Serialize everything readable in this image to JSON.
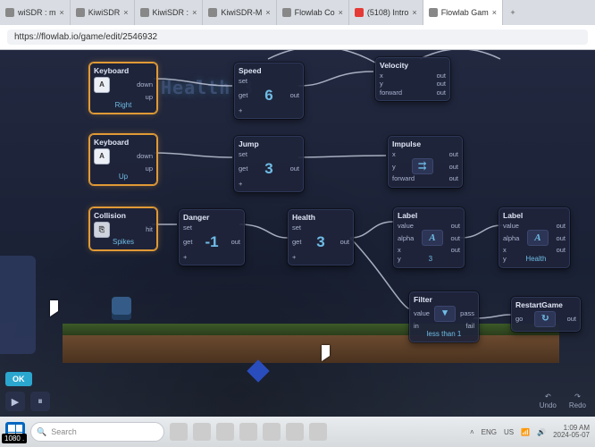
{
  "browser": {
    "tabs": [
      {
        "title": "wiSDR : m",
        "active": false
      },
      {
        "title": "KiwiSDR",
        "active": false
      },
      {
        "title": "KiwiSDR :",
        "active": false
      },
      {
        "title": "KiwiSDR-M",
        "active": false
      },
      {
        "title": "Flowlab Co",
        "active": false
      },
      {
        "title": "(5108) Intro",
        "active": false,
        "red": true
      },
      {
        "title": "Flowlab Gam",
        "active": true
      }
    ],
    "address": "https://flowlab.io/game/edit/2546932"
  },
  "hud": {
    "health_label": "Health 3"
  },
  "nodes": {
    "kb_right": {
      "title": "Keyboard",
      "key": "A",
      "p1": "down",
      "p2": "up",
      "sub": "Right"
    },
    "kb_up": {
      "title": "Keyboard",
      "key": "A",
      "p1": "down",
      "p2": "up",
      "sub": "Up"
    },
    "collision": {
      "title": "Collision",
      "p1": "hit",
      "sub": "Spikes"
    },
    "speed": {
      "title": "Speed",
      "in1": "set",
      "in2": "get",
      "in3": "+",
      "val": "6",
      "out": "out"
    },
    "jump": {
      "title": "Jump",
      "in1": "set",
      "in2": "get",
      "in3": "+",
      "val": "3",
      "out": "out"
    },
    "danger": {
      "title": "Danger",
      "in1": "set",
      "in2": "get",
      "in3": "+",
      "val": "-1",
      "out": "out"
    },
    "health": {
      "title": "Health",
      "in1": "set",
      "in2": "get",
      "in3": "+",
      "val": "3",
      "out": "out"
    },
    "velocity": {
      "title": "Velocity",
      "r1l": "x",
      "r1r": "out",
      "r2l": "y",
      "r2r": "out",
      "r3l": "forward",
      "r3r": "out"
    },
    "impulse": {
      "title": "Impulse",
      "r1l": "x",
      "r1r": "out",
      "r2l": "y",
      "r2r": "out",
      "r3l": "forward",
      "r3r": "out"
    },
    "label1": {
      "title": "Label",
      "r1l": "value",
      "r1r": "out",
      "r2l": "alpha",
      "r2r": "out",
      "r3l": "x",
      "r3r": "out",
      "r4l": "y",
      "sub": "3",
      "glyph": "A"
    },
    "label2": {
      "title": "Label",
      "r1l": "value",
      "r1r": "out",
      "r2l": "alpha",
      "r2r": "out",
      "r3l": "x",
      "r3r": "out",
      "r4l": "y",
      "sub": "Health",
      "glyph": "A"
    },
    "filter": {
      "title": "Filter",
      "r1l": "value",
      "r1r": "pass",
      "r2l": "in",
      "r2r": "fail",
      "sub": "less than 1"
    },
    "restart": {
      "title": "RestartGame",
      "r1l": "go",
      "r1r": "out",
      "glyph": "↻"
    }
  },
  "editor": {
    "ok": "OK",
    "undo": "Undo",
    "redo": "Redo"
  },
  "taskbar": {
    "search_placeholder": "Search",
    "lang": "ENG",
    "region": "US",
    "time": "1:09 AM",
    "date": "2024-05-07"
  },
  "overlay_badge": "1080 ."
}
